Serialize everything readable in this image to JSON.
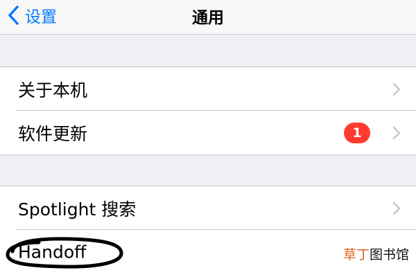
{
  "navbar": {
    "back_label": "设置",
    "title": "通用",
    "back_icon": "chevron-left-icon",
    "accent_color": "#007aff"
  },
  "groups": [
    {
      "rows": [
        {
          "label": "关于本机",
          "chevron_icon": "chevron-right-icon"
        },
        {
          "label": "软件更新",
          "badge": "1",
          "badge_color": "#ff3b30",
          "chevron_icon": "chevron-right-icon"
        }
      ]
    },
    {
      "rows": [
        {
          "label": "Spotlight 搜索",
          "chevron_icon": "chevron-right-icon"
        },
        {
          "label": "Handoff",
          "annotation": "hand-drawn black circle"
        }
      ]
    }
  ],
  "watermark": {
    "accent": "草丁",
    "rest": "图书馆",
    "accent_color": "#e0601c"
  }
}
